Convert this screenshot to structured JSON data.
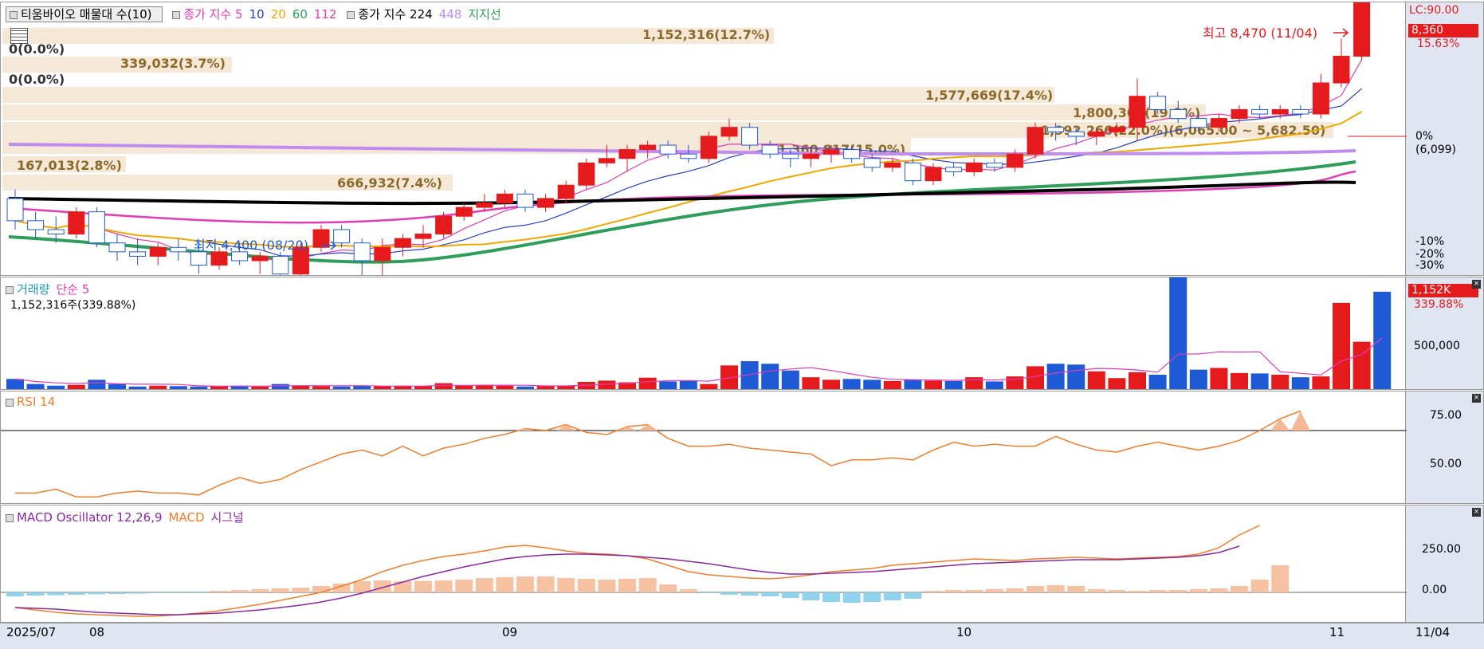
{
  "price_panel": {
    "legend": {
      "stock": "티움바이오 매물대 수(10)",
      "ma_label": "종가 지수 5",
      "ma10": "10",
      "ma20": "20",
      "ma60": "60",
      "ma112": "112",
      "ma224_label": "종가 지수 224",
      "ma448": "448",
      "support": "지지선"
    },
    "high_label": "최고 8,470 (11/04)",
    "low_label": "최저 4,400 (08/20)",
    "lc_label": "LC:90.00",
    "current_price": "8,360",
    "current_change": "15.63%",
    "zero_pct": "0%",
    "zero_price": "(6,099)",
    "pct_m10": "-10%",
    "pct_m20": "-20%",
    "pct_m30": "-30%",
    "volume_profile": [
      {
        "label": "1,152,316(12.7%)"
      },
      {
        "label": "0(0.0%)"
      },
      {
        "label": "339,032(3.7%)"
      },
      {
        "label": "0(0.0%)"
      },
      {
        "label": "1,577,669(17.4%)"
      },
      {
        "label": "1,800,305(19.8%)"
      },
      {
        "label": "1,992,266(22.0%)(6,065.00 ~ 5,682.50)"
      },
      {
        "label": "1,360,817(15.0%)"
      },
      {
        "label": "167,013(2.8%)"
      },
      {
        "label": "666,932(7.4%)"
      }
    ]
  },
  "volume_panel": {
    "title": "거래량",
    "ma_label": "단순 5",
    "value_label": "1,152,316주(339.88%)",
    "tag_value": "1,152K",
    "tag_pct": "339.88%",
    "axis_label": "500,000"
  },
  "rsi_panel": {
    "title": "RSI 14",
    "axis_75": "75.00",
    "axis_50": "50.00"
  },
  "macd_panel": {
    "title": "MACD Oscillator 12,26,9",
    "macd_label": "MACD",
    "signal_label": "시그널",
    "axis_250": "250.00",
    "axis_0": "0.00"
  },
  "x_axis": {
    "labels": [
      "2025/07",
      "08",
      "09",
      "10",
      "11"
    ],
    "right_label": "11/04"
  },
  "colors": {
    "up": "#e41a1c",
    "down": "#1e5ad6",
    "ma5": "#e23bb5",
    "ma10": "#2540c8",
    "ma20": "#f0a800",
    "ma60": "#2f9e5a",
    "ma112": "#e23bb5",
    "ma224": "#000000",
    "ma448": "#c08cf0",
    "rsi": "#f07d2a",
    "macd": "#f07d2a",
    "signal": "#8a2aa0"
  },
  "chart_data": {
    "type": "candlestick",
    "candles": [
      {
        "o": 5400,
        "h": 5500,
        "l": 5050,
        "c": 5150
      },
      {
        "o": 5150,
        "h": 5250,
        "l": 4950,
        "c": 5050
      },
      {
        "o": 5050,
        "h": 5200,
        "l": 4900,
        "c": 5000
      },
      {
        "o": 5000,
        "h": 5300,
        "l": 4950,
        "c": 5250
      },
      {
        "o": 5250,
        "h": 5300,
        "l": 4850,
        "c": 4900
      },
      {
        "o": 4900,
        "h": 5000,
        "l": 4700,
        "c": 4800
      },
      {
        "o": 4800,
        "h": 4950,
        "l": 4650,
        "c": 4750
      },
      {
        "o": 4750,
        "h": 4900,
        "l": 4650,
        "c": 4850
      },
      {
        "o": 4850,
        "h": 4950,
        "l": 4700,
        "c": 4800
      },
      {
        "o": 4800,
        "h": 4900,
        "l": 4550,
        "c": 4650
      },
      {
        "o": 4650,
        "h": 4850,
        "l": 4600,
        "c": 4800
      },
      {
        "o": 4800,
        "h": 4900,
        "l": 4650,
        "c": 4700
      },
      {
        "o": 4700,
        "h": 4800,
        "l": 4550,
        "c": 4750
      },
      {
        "o": 4750,
        "h": 4800,
        "l": 4500,
        "c": 4550
      },
      {
        "o": 4550,
        "h": 4900,
        "l": 4500,
        "c": 4850
      },
      {
        "o": 4850,
        "h": 5100,
        "l": 4800,
        "c": 5050
      },
      {
        "o": 5050,
        "h": 5100,
        "l": 4850,
        "c": 4900
      },
      {
        "o": 4900,
        "h": 4950,
        "l": 4400,
        "c": 4700
      },
      {
        "o": 4700,
        "h": 4950,
        "l": 4500,
        "c": 4850
      },
      {
        "o": 4850,
        "h": 5000,
        "l": 4750,
        "c": 4950
      },
      {
        "o": 4950,
        "h": 5100,
        "l": 4850,
        "c": 5000
      },
      {
        "o": 5000,
        "h": 5250,
        "l": 4950,
        "c": 5200
      },
      {
        "o": 5200,
        "h": 5350,
        "l": 5150,
        "c": 5300
      },
      {
        "o": 5300,
        "h": 5450,
        "l": 5250,
        "c": 5350
      },
      {
        "o": 5350,
        "h": 5500,
        "l": 5300,
        "c": 5450
      },
      {
        "o": 5450,
        "h": 5500,
        "l": 5250,
        "c": 5300
      },
      {
        "o": 5300,
        "h": 5450,
        "l": 5250,
        "c": 5400
      },
      {
        "o": 5400,
        "h": 5600,
        "l": 5350,
        "c": 5550
      },
      {
        "o": 5550,
        "h": 5850,
        "l": 5500,
        "c": 5800
      },
      {
        "o": 5800,
        "h": 6000,
        "l": 5750,
        "c": 5850
      },
      {
        "o": 5850,
        "h": 6000,
        "l": 5700,
        "c": 5950
      },
      {
        "o": 5950,
        "h": 6050,
        "l": 5850,
        "c": 6000
      },
      {
        "o": 6000,
        "h": 6050,
        "l": 5850,
        "c": 5900
      },
      {
        "o": 5900,
        "h": 6000,
        "l": 5800,
        "c": 5850
      },
      {
        "o": 5850,
        "h": 6150,
        "l": 5800,
        "c": 6100
      },
      {
        "o": 6100,
        "h": 6300,
        "l": 6050,
        "c": 6200
      },
      {
        "o": 6200,
        "h": 6250,
        "l": 5950,
        "c": 6000
      },
      {
        "o": 6000,
        "h": 6050,
        "l": 5850,
        "c": 5900
      },
      {
        "o": 5900,
        "h": 5950,
        "l": 5750,
        "c": 5850
      },
      {
        "o": 5850,
        "h": 5950,
        "l": 5750,
        "c": 5900
      },
      {
        "o": 5900,
        "h": 6000,
        "l": 5800,
        "c": 5950
      },
      {
        "o": 5950,
        "h": 6000,
        "l": 5800,
        "c": 5850
      },
      {
        "o": 5850,
        "h": 5900,
        "l": 5700,
        "c": 5750
      },
      {
        "o": 5750,
        "h": 5850,
        "l": 5700,
        "c": 5800
      },
      {
        "o": 5800,
        "h": 5850,
        "l": 5550,
        "c": 5600
      },
      {
        "o": 5600,
        "h": 5800,
        "l": 5550,
        "c": 5750
      },
      {
        "o": 5750,
        "h": 5800,
        "l": 5650,
        "c": 5700
      },
      {
        "o": 5700,
        "h": 5850,
        "l": 5650,
        "c": 5800
      },
      {
        "o": 5800,
        "h": 5850,
        "l": 5700,
        "c": 5750
      },
      {
        "o": 5750,
        "h": 5950,
        "l": 5700,
        "c": 5900
      },
      {
        "o": 5900,
        "h": 6250,
        "l": 5850,
        "c": 6200
      },
      {
        "o": 6200,
        "h": 6250,
        "l": 6050,
        "c": 6150
      },
      {
        "o": 6150,
        "h": 6200,
        "l": 6000,
        "c": 6100
      },
      {
        "o": 6100,
        "h": 6200,
        "l": 6000,
        "c": 6150
      },
      {
        "o": 6150,
        "h": 6250,
        "l": 6100,
        "c": 6200
      },
      {
        "o": 6200,
        "h": 6750,
        "l": 6050,
        "c": 6550
      },
      {
        "o": 6550,
        "h": 6600,
        "l": 6350,
        "c": 6400
      },
      {
        "o": 6400,
        "h": 6500,
        "l": 6250,
        "c": 6300
      },
      {
        "o": 6300,
        "h": 6350,
        "l": 6150,
        "c": 6200
      },
      {
        "o": 6200,
        "h": 6350,
        "l": 6150,
        "c": 6300
      },
      {
        "o": 6300,
        "h": 6450,
        "l": 6250,
        "c": 6400
      },
      {
        "o": 6400,
        "h": 6450,
        "l": 6300,
        "c": 6350
      },
      {
        "o": 6350,
        "h": 6450,
        "l": 6300,
        "c": 6400
      },
      {
        "o": 6400,
        "h": 6450,
        "l": 6300,
        "c": 6350
      },
      {
        "o": 6350,
        "h": 6800,
        "l": 6300,
        "c": 6700
      },
      {
        "o": 6700,
        "h": 7200,
        "l": 6650,
        "c": 7000
      },
      {
        "o": 7000,
        "h": 8470,
        "l": 6950,
        "c": 8360
      }
    ],
    "volume": [
      120,
      60,
      40,
      50,
      110,
      60,
      30,
      40,
      35,
      30,
      35,
      40,
      30,
      60,
      40,
      35,
      30,
      40,
      35,
      40,
      35,
      70,
      40,
      45,
      40,
      30,
      35,
      40,
      85,
      100,
      80,
      135,
      90,
      100,
      60,
      280,
      330,
      300,
      220,
      140,
      110,
      120,
      110,
      95,
      115,
      100,
      95,
      140,
      90,
      150,
      270,
      300,
      290,
      210,
      130,
      200,
      170,
      1350,
      230,
      250,
      190,
      185,
      170,
      140,
      150,
      1020,
      560,
      1152
    ],
    "rsi": [
      38,
      38,
      40,
      36,
      36,
      38,
      39,
      38,
      38,
      37,
      42,
      46,
      43,
      45,
      50,
      54,
      58,
      60,
      57,
      62,
      57,
      61,
      63,
      66,
      68,
      71,
      70,
      73,
      69,
      68,
      72,
      73,
      66,
      62,
      62,
      63,
      61,
      60,
      59,
      58,
      52,
      55,
      55,
      56,
      55,
      60,
      64,
      62,
      63,
      62,
      62,
      67,
      63,
      60,
      59,
      62,
      64,
      62,
      60,
      62,
      65,
      70,
      76,
      80
    ],
    "macd_osc": [
      -25,
      -20,
      -18,
      -15,
      -12,
      -10,
      -8,
      -5,
      -3,
      -2,
      10,
      15,
      20,
      25,
      30,
      40,
      55,
      70,
      75,
      70,
      72,
      75,
      80,
      90,
      95,
      100,
      100,
      90,
      85,
      80,
      85,
      90,
      50,
      20,
      -5,
      -15,
      -20,
      -25,
      -35,
      -50,
      -60,
      -65,
      -60,
      -50,
      -40,
      10,
      15,
      15,
      20,
      25,
      40,
      45,
      40,
      20,
      15,
      10,
      15,
      15,
      20,
      25,
      40,
      80,
      170
    ],
    "macd": [
      -95,
      -110,
      -125,
      -135,
      -140,
      -145,
      -150,
      -148,
      -140,
      -130,
      -115,
      -95,
      -75,
      -50,
      -25,
      0,
      40,
      80,
      130,
      170,
      200,
      225,
      240,
      260,
      285,
      295,
      280,
      260,
      245,
      240,
      230,
      210,
      170,
      130,
      110,
      100,
      90,
      85,
      95,
      110,
      130,
      140,
      150,
      170,
      180,
      190,
      200,
      210,
      205,
      200,
      210,
      215,
      220,
      215,
      210,
      215,
      220,
      225,
      240,
      280,
      360,
      420
    ],
    "signal": [
      -95,
      -100,
      -105,
      -115,
      -125,
      -130,
      -135,
      -140,
      -140,
      -135,
      -130,
      -120,
      -110,
      -95,
      -80,
      -60,
      -35,
      -5,
      30,
      65,
      100,
      130,
      160,
      185,
      210,
      225,
      235,
      240,
      240,
      235,
      230,
      220,
      210,
      195,
      180,
      160,
      140,
      125,
      115,
      115,
      120,
      125,
      130,
      140,
      150,
      160,
      170,
      180,
      185,
      190,
      195,
      200,
      205,
      205,
      205,
      210,
      215,
      220,
      230,
      250,
      290
    ]
  }
}
